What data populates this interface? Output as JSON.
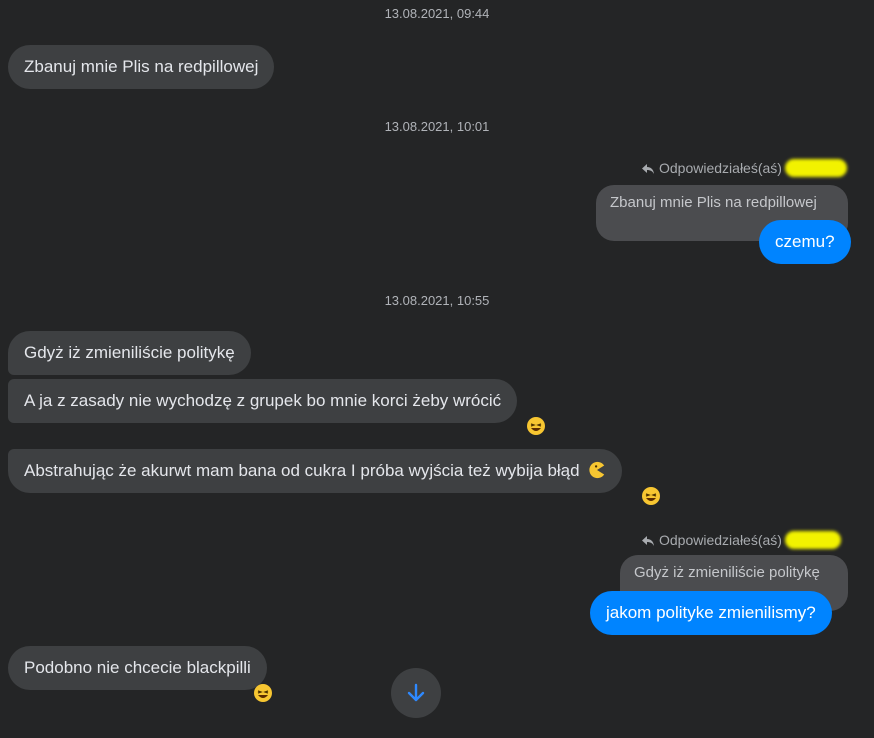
{
  "timestamps": [
    "13.08.2021, 09:44",
    "13.08.2021, 10:01",
    "13.08.2021, 10:55"
  ],
  "messages": {
    "m1": "Zbanuj mnie Plis na redpillowej",
    "m2_quote": "Zbanuj mnie Plis na redpillowej",
    "m2_reply": "czemu?",
    "m3": "Gdyż iż zmieniliście politykę",
    "m4": "A ja z zasady nie wychodzę z grupek bo mnie korci żeby wrócić",
    "m5": "Abstrahując że akurwt mam bana od cukra I próba wyjścia też wybija błąd",
    "m6_quote": "Gdyż iż zmieniliście politykę",
    "m6_reply": "jakom polityke zmienilismy?",
    "m7": "Podobno nie chcecie blackpilli"
  },
  "reply_header": {
    "label_1": "Odpowiedziałeś(aś)",
    "label_2": "Odpowiedziałeś(aś)"
  },
  "reactions": {
    "m4": "laughing-emoji",
    "m5": "laughing-emoji",
    "m7": "laughing-emoji",
    "m5_inline": "pacman-emoji"
  },
  "colors": {
    "background": "#242526",
    "incoming_bubble": "#3e4042",
    "outgoing_bubble": "#0084ff",
    "redaction": "#f2f200"
  },
  "scroll_button": {
    "icon": "arrow-down-icon"
  }
}
